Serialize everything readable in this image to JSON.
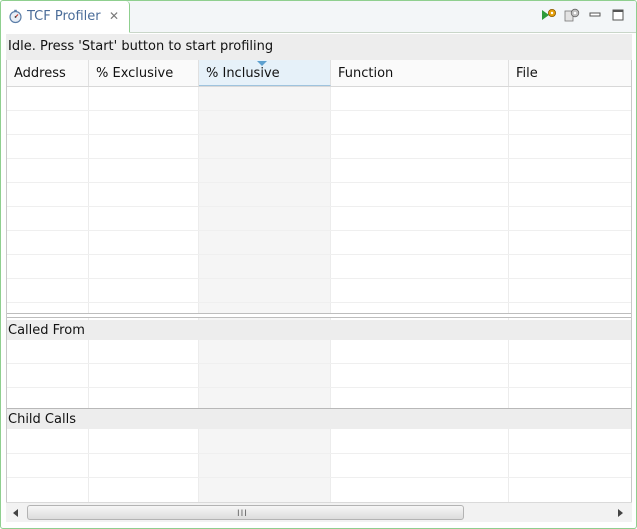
{
  "tab": {
    "title": "TCF Profiler",
    "close_glyph": "✕",
    "icon": "profiler-view-icon"
  },
  "toolbar": {
    "buttons": [
      {
        "name": "start-profiling-button",
        "icon": "start-profile-icon"
      },
      {
        "name": "profiler-configuration-button",
        "icon": "gear-config-icon"
      },
      {
        "name": "minimize-button",
        "icon": "minimize-icon"
      },
      {
        "name": "maximize-button",
        "icon": "maximize-icon"
      }
    ]
  },
  "status": {
    "text": "Idle. Press 'Start' button to start profiling"
  },
  "table": {
    "columns": [
      "Address",
      "% Exclusive",
      "% Inclusive",
      "Function",
      "File"
    ],
    "sorted_column": "% Inclusive",
    "rows": []
  },
  "sections": {
    "called_from": "Called From",
    "child_calls": "Child Calls"
  },
  "scrollbar": {
    "grip": "III"
  },
  "colors": {
    "tab_border": "#8fcf8f",
    "tab_text": "#4a6c99",
    "sort_highlight": "#e6f1f9",
    "sort_arrow": "#5da0cf"
  }
}
